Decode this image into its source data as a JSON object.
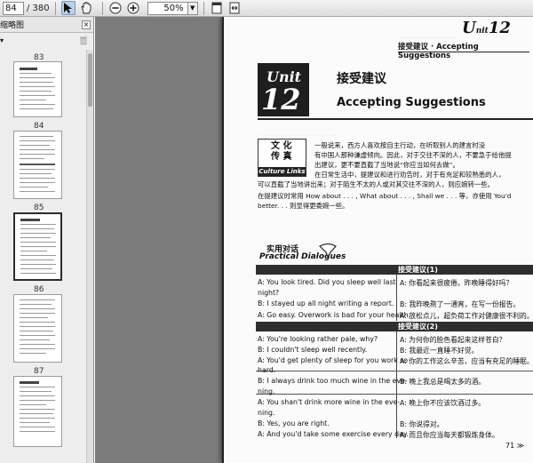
{
  "toolbar": {
    "current_page": "84",
    "total_pages": "/ 380",
    "zoom": "50%"
  },
  "sidebar": {
    "title": "缩略图",
    "close_glyph": "×",
    "thumb_labels": [
      "83",
      "84",
      "85",
      "86",
      "87"
    ]
  },
  "page": {
    "header_unit_prefix": "U",
    "header_unit_small": "nit",
    "header_unit_number": "12",
    "header_subtitle": "接受建议 · Accepting Suggestions",
    "unit_word": "Unit",
    "unit_number": "12",
    "title_cn": "接受建议",
    "title_en": "Accepting Suggestions",
    "culture_cn_1": "文 化",
    "culture_cn_2": "传 真",
    "culture_en": "Culture Links",
    "culture_para": [
      "一般说来，西方人喜欢按自主行动，在听取别人的建言时没",
      "有中国人那种谦虚倾向。因此，对于交往不深的人，不要急于给他提",
      "出建议，更不要直截了当地说“你应当如何去做”。",
      "在日常生活中，提建议和进行劝告时，对于有充足和较熟悉的人，",
      "可以直截了当地讲出来；对于陌生不太的人或对其交往不深的人，则应婉转一些。",
      "在提建议时常用 How about . . . , What about . . . , Shall we . . . 等，亦使用 You'd",
      "better. . . 则显得更委婉一些。"
    ],
    "practical_cn": "实用对话",
    "practical_en": "Practical Dialogues",
    "dialogue1_label": "接受建议(1)",
    "dialogue2_label": "接受建议(2)",
    "dialogue1": {
      "en": [
        "A: You look tired.  Did you sleep well last",
        "night?",
        "B: I stayed up all night writing a report.",
        "A: Go easy.  Overwork is bad for your health."
      ],
      "cn": [
        "A: 你看起来很疲倦。昨晚睡得好吗？",
        "B: 我昨晚熬了一通宵，在写一份报告。",
        "A: 放松点儿，超负荷工作对健康很不利的。"
      ]
    },
    "dialogue2": {
      "en": [
        "A: You're looking rather pale, why?",
        "B: I couldn't sleep well recently.",
        "A: You'd get plenty of sleep for you work so",
        "hard.",
        "B: I always drink too much wine in the eve-",
        "ning.",
        "A: You shan't drink more wine in the eve-",
        "ning.",
        "B: Yes, you are right.",
        "A: And you'd take some exercise every day."
      ],
      "cn": [
        "A: 为何你的脸色看起来这样苍白？",
        "B: 我最近一直睡不好觉。",
        "A: 你的工作这么辛苦，应当有充足的睡眠。",
        "B: 晚上我总是喝太多的酒。",
        "A: 晚上你不应该饮酒过多。",
        "B: 你说得对。",
        "A: 而且你应当每天都锻炼身体。"
      ]
    },
    "page_number": "71 ≫"
  }
}
